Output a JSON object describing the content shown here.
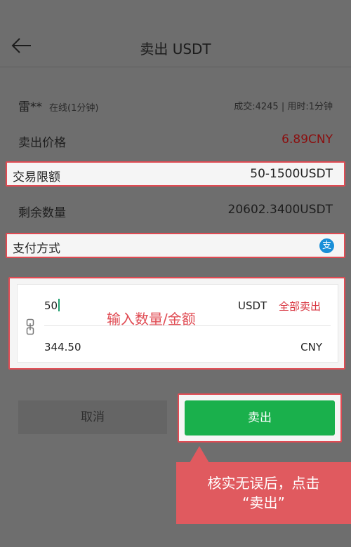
{
  "header": {
    "title": "卖出 USDT",
    "back_icon": "arrow-left-icon"
  },
  "seller": {
    "name": "雷**",
    "status": "在线(1分钟)",
    "stats": "成交:4245 | 用时:1分钟"
  },
  "price": {
    "label": "卖出价格",
    "value": "6.89CNY",
    "color": "#8b0e0e"
  },
  "limit": {
    "label": "交易限额",
    "value": "50-1500USDT"
  },
  "remaining": {
    "label": "剩余数量",
    "value": "20602.3400USDT"
  },
  "payment": {
    "label": "支付方式",
    "icon": "alipay-icon",
    "icon_text": "支"
  },
  "amount": {
    "usdt_value": "50",
    "usdt_unit": "USDT",
    "sell_all": "全部卖出",
    "cny_value": "344.50",
    "cny_unit": "CNY"
  },
  "annotations": {
    "input_hint": "输入数量/金额",
    "callout_line1": "核实无误后，点击",
    "callout_line2": "“卖出”"
  },
  "actions": {
    "cancel": "取消",
    "sell": "卖出"
  },
  "colors": {
    "accent_green": "#1ab04c",
    "highlight_red": "#e04b53",
    "alipay_blue": "#1a8fd8"
  }
}
